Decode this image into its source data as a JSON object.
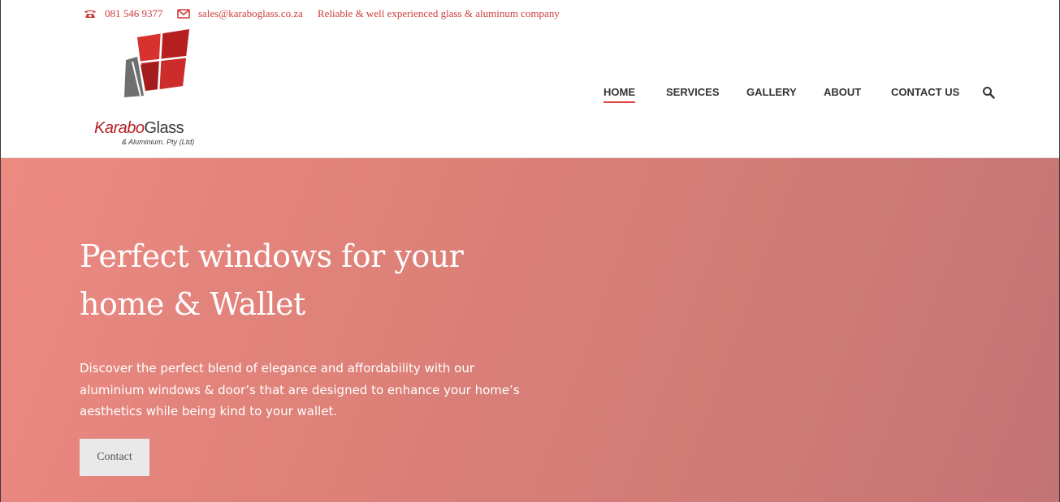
{
  "topbar": {
    "phone": "081 546 9377",
    "email": "sales@karaboglass.co.za",
    "tagline": "Reliable & well experienced glass & aluminum company"
  },
  "logo": {
    "name_part1": "Karabo",
    "name_part2": "Glass",
    "subtitle": "& Aluminium. Pty (Ltd)"
  },
  "nav": {
    "items": [
      {
        "label": "HOME",
        "active": true
      },
      {
        "label": "SERVICES"
      },
      {
        "label": "GALLERY"
      },
      {
        "label": "ABOUT"
      },
      {
        "label": "CONTACT US"
      }
    ],
    "search_icon": "search-icon"
  },
  "hero": {
    "title": "Perfect windows for your home & Wallet",
    "text": "Discover the perfect blend of elegance and affordability with our aluminium windows & door’s that are designed to enhance your home’s aesthetics while being kind to your wallet.",
    "button_label": "Contact"
  },
  "colors": {
    "accent": "#cf3a3a",
    "hero_start": "#ec8a82",
    "hero_end": "#c47374",
    "button_bg": "#e9e9e9"
  }
}
